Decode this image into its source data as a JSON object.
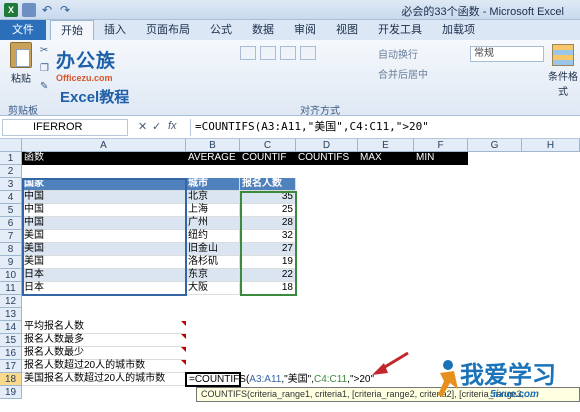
{
  "window": {
    "title": "必会的33个函数 - Microsoft Excel",
    "app_icon": "X"
  },
  "ribbon": {
    "file_tab": "文件",
    "tabs": [
      "开始",
      "插入",
      "页面布局",
      "公式",
      "数据",
      "审阅",
      "视图",
      "开发工具",
      "加载项"
    ],
    "paste_label": "粘贴",
    "clipboard_label": "剪贴板",
    "alignment_label": "对齐方式",
    "wrap_text": "自动换行",
    "merge_center": "合并后居中",
    "number_format": "常规",
    "cond_format": "条件格式"
  },
  "logo": {
    "main": "办公族",
    "url": "Officezu.com",
    "sub": "Excel教程"
  },
  "formula_bar": {
    "name_box": "IFERROR",
    "cancel": "✕",
    "enter": "✓",
    "fx": "fx",
    "formula": "=COUNTIFS(A3:A11,\"美国\",C4:C11,\">20\""
  },
  "columns": [
    "A",
    "B",
    "C",
    "D",
    "E",
    "F",
    "G",
    "H"
  ],
  "rows": [
    "1",
    "2",
    "3",
    "4",
    "5",
    "6",
    "7",
    "8",
    "9",
    "10",
    "11",
    "12",
    "13",
    "14",
    "15",
    "16",
    "17",
    "18",
    "19"
  ],
  "row1": {
    "a": "函数",
    "b": "AVERAGE",
    "c": "COUNTIF",
    "d": "COUNTIFS",
    "e": "MAX",
    "f": "MIN"
  },
  "table": {
    "headers": [
      "国家",
      "城市",
      "报名人数"
    ],
    "rows": [
      [
        "中国",
        "北京",
        "35"
      ],
      [
        "中国",
        "上海",
        "25"
      ],
      [
        "中国",
        "广州",
        "28"
      ],
      [
        "美国",
        "纽约",
        "32"
      ],
      [
        "美国",
        "旧金山",
        "27"
      ],
      [
        "美国",
        "洛杉矶",
        "19"
      ],
      [
        "日本",
        "东京",
        "22"
      ],
      [
        "日本",
        "大阪",
        "18"
      ]
    ]
  },
  "labels": {
    "r14": "平均报名人数",
    "r15": "报名人数最多",
    "r16": "报名人数最少",
    "r17": "报名人数超过20人的城市数",
    "r18": "美国报名人数超过20人的城市数"
  },
  "editing": {
    "prefix": "=COUNTIFS(",
    "arg1": "A3:A11",
    "mid": ",\"美国\",",
    "arg2": "C4:C11",
    "suffix": ",\">20\""
  },
  "tooltip": "COUNTIFS(criteria_range1, criteria1, [criteria_range2, criteria2], [criteria_range3, ...",
  "watermark": {
    "main": "我爱学习",
    "url": "5ixue.com"
  },
  "colors": {
    "file_tab": "#2b6fba",
    "table_header": "#4f81bd",
    "stripe": "#dbe5f1",
    "range_green": "#3c8a3c",
    "range_blue": "#3465a4"
  }
}
